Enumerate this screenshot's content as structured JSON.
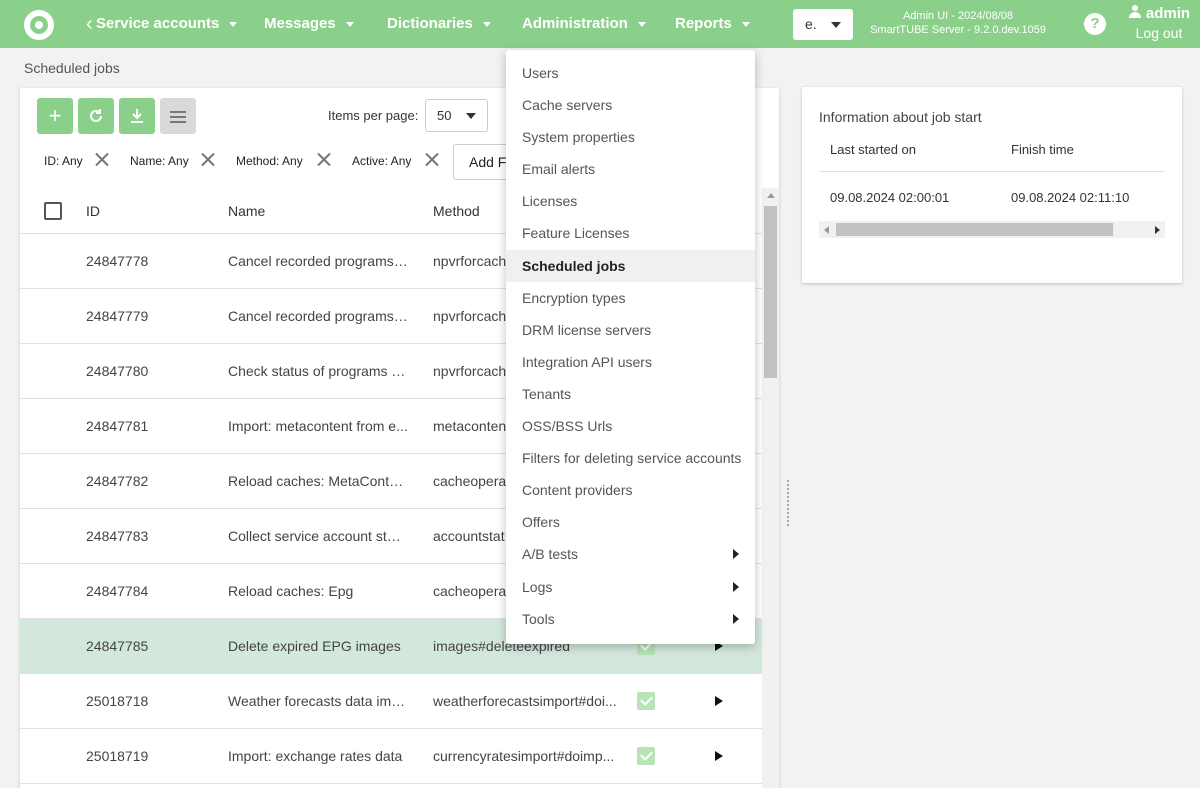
{
  "topbar": {
    "nav": [
      {
        "label": "Service accounts"
      },
      {
        "label": "Messages"
      },
      {
        "label": "Dictionaries"
      },
      {
        "label": "Administration"
      },
      {
        "label": "Reports"
      }
    ],
    "language_select": "e.",
    "server_line1": "Admin UI - 2024/08/08",
    "server_line2": "SmartTUBE Server - 9.2.0.dev.1059",
    "help": "?",
    "user": "admin",
    "logout": "Log out",
    "colors": {
      "accent": "#8bd08a"
    }
  },
  "breadcrumb": "Scheduled jobs",
  "toolbar": {
    "icons": [
      "add-icon",
      "refresh-icon",
      "download-icon",
      "menu-icon"
    ],
    "items_per_page_label": "Items per page:",
    "items_per_page_value": "50"
  },
  "filters": [
    {
      "label": "ID: Any"
    },
    {
      "label": "Name: Any"
    },
    {
      "label": "Method: Any"
    },
    {
      "label": "Active: Any"
    }
  ],
  "add_filter_label": "Add F",
  "table": {
    "columns": [
      "ID",
      "Name",
      "Method"
    ],
    "rows": [
      {
        "id": "24847778",
        "name": "Cancel recorded programs ...",
        "method": "npvrforcach"
      },
      {
        "id": "24847779",
        "name": "Cancel recorded programs b...",
        "method": "npvrforcach"
      },
      {
        "id": "24847780",
        "name": "Check status of programs o...",
        "method": "npvrforcach"
      },
      {
        "id": "24847781",
        "name": "Import: metacontent from e...",
        "method": "metacontent"
      },
      {
        "id": "24847782",
        "name": "Reload caches: MetaConten...",
        "method": "cacheoperat"
      },
      {
        "id": "24847783",
        "name": "Collect service account stati...",
        "method": "accountstat"
      },
      {
        "id": "24847784",
        "name": "Reload caches: Epg",
        "method": "cacheoperat"
      },
      {
        "id": "24847785",
        "name": "Delete expired EPG images",
        "method": "images#deleteexpired",
        "selected": true
      },
      {
        "id": "25018718",
        "name": "Weather forecasts data imp...",
        "method": "weatherforecastsimport#doi..."
      },
      {
        "id": "25018719",
        "name": "Import: exchange rates data",
        "method": "currencyratesimport#doimp..."
      }
    ]
  },
  "info": {
    "title": "Information about job start",
    "columns": [
      "Last started on",
      "Finish time"
    ],
    "last_started": "09.08.2024 02:00:01",
    "finish_time": "09.08.2024 02:11:10"
  },
  "menu": {
    "items": [
      {
        "label": "Users"
      },
      {
        "label": "Cache servers"
      },
      {
        "label": "System properties"
      },
      {
        "label": "Email alerts"
      },
      {
        "label": "Licenses"
      },
      {
        "label": "Feature Licenses"
      },
      {
        "label": "Scheduled jobs",
        "active": true
      },
      {
        "label": "Encryption types"
      },
      {
        "label": "DRM license servers"
      },
      {
        "label": "Integration API users"
      },
      {
        "label": "Tenants"
      },
      {
        "label": "OSS/BSS Urls"
      },
      {
        "label": "Filters for deleting service accounts"
      },
      {
        "label": "Content providers"
      },
      {
        "label": "Offers"
      },
      {
        "label": "A/B tests",
        "submenu": true
      },
      {
        "label": "Logs",
        "submenu": true
      },
      {
        "label": "Tools",
        "submenu": true
      }
    ]
  }
}
